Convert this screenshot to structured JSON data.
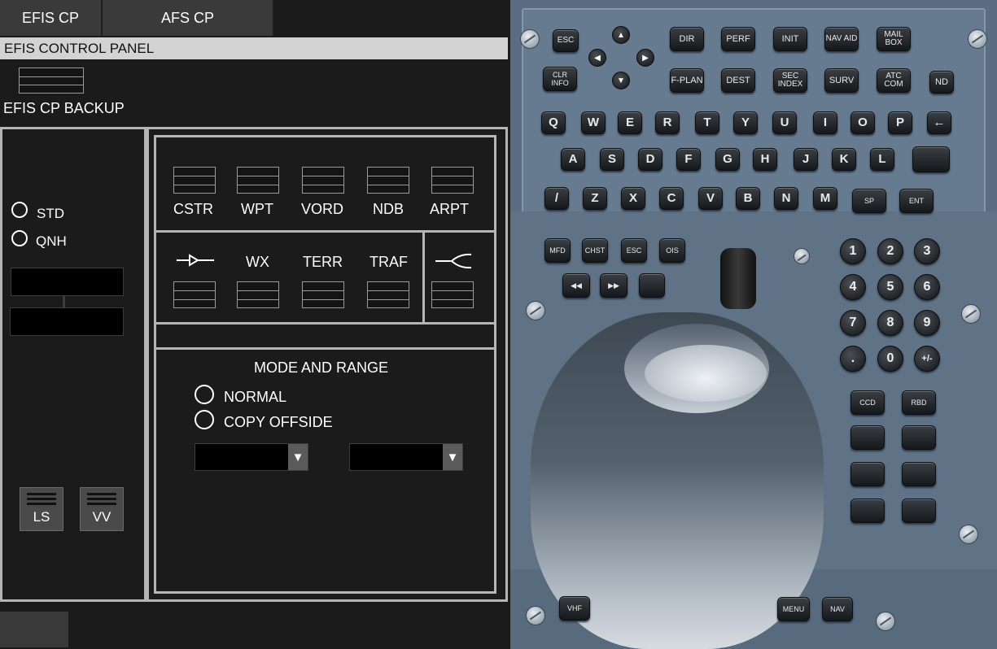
{
  "tabs": [
    "EFIS CP",
    "AFS CP"
  ],
  "section_header": "EFIS CONTROL PANEL",
  "backup_label": "EFIS CP BACKUP",
  "baro": {
    "std": "STD",
    "qnh": "QNH"
  },
  "waypoint_buttons": [
    "CSTR",
    "WPT",
    "VORD",
    "NDB",
    "ARPT"
  ],
  "overlay_buttons": [
    "WX",
    "TERR",
    "TRAF"
  ],
  "mode_and_range": {
    "title": "MODE AND RANGE",
    "normal": "NORMAL",
    "copy_offside": "COPY OFFSIDE"
  },
  "bottom_buttons": [
    "LS",
    "VV"
  ],
  "mcdu": {
    "row1": [
      "DIR",
      "PERF",
      "INIT",
      "NAV AID",
      "MAIL BOX"
    ],
    "row2": [
      "CLR INFO",
      "F-PLAN",
      "DEST",
      "SEC INDEX",
      "SURV",
      "ATC COM",
      "ND"
    ],
    "esc": "ESC",
    "alpha_row1": [
      "Q",
      "W",
      "E",
      "R",
      "T",
      "Y",
      "U",
      "I",
      "O",
      "P",
      "←"
    ],
    "alpha_row2": [
      "A",
      "S",
      "D",
      "F",
      "G",
      "H",
      "J",
      "K",
      "L"
    ],
    "alpha_row3": [
      "/",
      "Z",
      "X",
      "C",
      "V",
      "B",
      "N",
      "M",
      "SP",
      "ENT"
    ],
    "func_row": [
      "MFD",
      "CHST",
      "ESC",
      "OIS"
    ],
    "media_row": [
      "◀◀",
      "▶▶"
    ],
    "numpad": [
      "1",
      "2",
      "3",
      "4",
      "5",
      "6",
      "7",
      "8",
      "9",
      ".",
      "0",
      "+/-"
    ],
    "side_keys": [
      "CCD",
      "RBD"
    ],
    "bottom_keys": [
      "VHF",
      "MENU",
      "NAV"
    ]
  },
  "icons": [
    "arrow-up-icon",
    "arrow-down-icon",
    "arrow-left-icon",
    "arrow-right-icon",
    "dropdown-arrow-icon"
  ]
}
